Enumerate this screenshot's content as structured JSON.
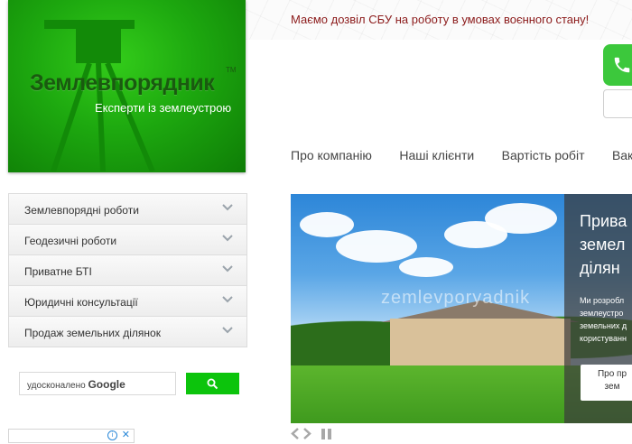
{
  "logo": {
    "title": "Землевпорядник",
    "tm": "TM",
    "subtitle": "Експерти із землеустрою"
  },
  "notice": "Маємо дозвіл СБУ на роботу в умовах воєнного стану!",
  "topnav": [
    "Про компанію",
    "Наші клієнти",
    "Вартість робіт",
    "Вака"
  ],
  "sidemenu": [
    "Землевпорядні роботи",
    "Геодезичні роботи",
    "Приватне БТІ",
    "Юридичні консультації",
    "Продаж земельних ділянок"
  ],
  "search": {
    "placeholder_prefix": "удосконалено",
    "placeholder_brand": "Google"
  },
  "slider": {
    "watermark": "zemlevporyadnik",
    "caption_lines": [
      "Прива",
      "земел",
      "ділян"
    ],
    "desc_lines": [
      "Ми розробл",
      "землеустро",
      "земельних д",
      "користуванн"
    ],
    "button_lines": [
      "Про пр",
      "зем"
    ]
  },
  "colors": {
    "brand_green": "#1da80f",
    "notice_red": "#8b1a1a",
    "search_green": "#0cc40c"
  }
}
